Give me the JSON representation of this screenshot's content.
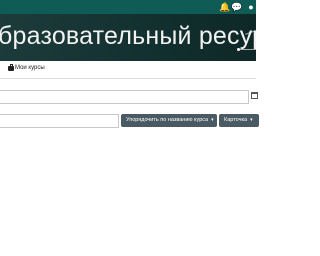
{
  "header": {
    "icons": [
      "bell-icon",
      "chat-icon",
      "user-menu-icon"
    ]
  },
  "banner": {
    "title": "бразовательный ресурс"
  },
  "nav": {
    "my_courses_label": "Мои курсы"
  },
  "controls": {
    "sort_label": "Упорядочить по названию курса",
    "view_label": "Карточка"
  },
  "colors": {
    "topbar": "#0f5b56",
    "banner": "#1d3b3a",
    "button": "#4a5a63"
  }
}
